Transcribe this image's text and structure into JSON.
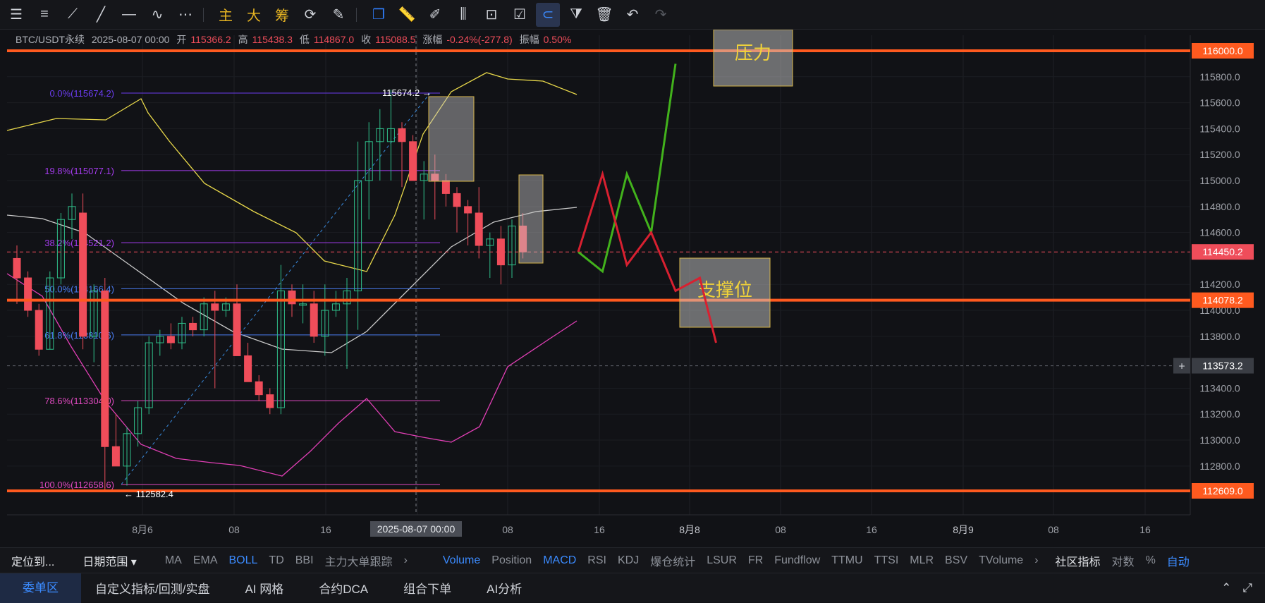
{
  "toolbar": {
    "text_tools": [
      "主",
      "大",
      "筹"
    ]
  },
  "info": {
    "symbol": "BTC/USDT永续",
    "datetime": "2025-08-07 00:00",
    "open_label": "开",
    "open": "115366.2",
    "high_label": "高",
    "high": "115438.3",
    "low_label": "低",
    "low": "114867.0",
    "close_label": "收",
    "close": "115088.5",
    "change_label": "涨幅",
    "change": "-0.24%(-277.8)",
    "amp_label": "振幅",
    "amp": "0.50%"
  },
  "colors": {
    "up": "#2fbf8a",
    "down": "#ef4d5a",
    "accent": "#3b8bff",
    "level": "#ff5a1f",
    "fib": "#8a3cf0"
  },
  "chart_data": {
    "type": "candlestick",
    "ylim": [
      112400,
      116200
    ],
    "y_ticks": [
      "115800.0",
      "115600.0",
      "115400.0",
      "115200.0",
      "115000.0",
      "114800.0",
      "114600.0",
      "114200.0",
      "114000.0",
      "113800.0",
      "113400.0",
      "113200.0",
      "113000.0",
      "112800.0"
    ],
    "x_ticks": [
      "8月6",
      "08",
      "16",
      "8月8",
      "08",
      "16",
      "8月9",
      "08",
      "16"
    ],
    "crosshair_x_label": "2025-08-07 00:00",
    "crosshair_top_label": "115674.2",
    "low_label": "← 112582.4",
    "fib_levels": [
      {
        "label": "0.0%(115674.2)",
        "price": 115674.2
      },
      {
        "label": "19.8%(115077.1)",
        "price": 115077.1
      },
      {
        "label": "38.2%(114521.2)",
        "price": 114521.2
      },
      {
        "label": "50.0%(114166.4)",
        "price": 114166.4
      },
      {
        "label": "61.8%(113810.6)",
        "price": 113810.6
      },
      {
        "label": "78.6%(113304.0)",
        "price": 113304.0
      },
      {
        "label": "100.0%(112658.6)",
        "price": 112658.6
      }
    ],
    "horizontal_levels": [
      {
        "price_label": "116000.0",
        "price": 116000.0
      },
      {
        "price_label": "114078.2",
        "price": 114078.2
      },
      {
        "price_label": "112609.0",
        "price": 112609.0
      }
    ],
    "current_price": {
      "label": "114450.2",
      "price": 114450.2
    },
    "cursor_price": {
      "label": "113573.2",
      "price": 113573.2
    },
    "annotations": [
      {
        "text": "压力",
        "price": 115900
      },
      {
        "text": "支撑位",
        "price": 114150
      }
    ],
    "candles": [
      [
        114400,
        114500,
        114050,
        114250
      ],
      [
        114250,
        114300,
        113950,
        114000
      ],
      [
        114000,
        114050,
        113650,
        113700
      ],
      [
        113700,
        114300,
        113700,
        114250
      ],
      [
        114250,
        114750,
        114200,
        114700
      ],
      [
        114700,
        114900,
        114550,
        114800
      ],
      [
        114750,
        114900,
        113700,
        113800
      ],
      [
        113800,
        114200,
        113600,
        114150
      ],
      [
        114150,
        114250,
        112600,
        112950
      ],
      [
        112950,
        113200,
        112800,
        112800
      ],
      [
        112800,
        113100,
        112650,
        113050
      ],
      [
        113050,
        113300,
        112950,
        113250
      ],
      [
        113250,
        113800,
        113200,
        113750
      ],
      [
        113750,
        113850,
        113650,
        113800
      ],
      [
        113800,
        113900,
        113700,
        113750
      ],
      [
        113750,
        113950,
        113700,
        113900
      ],
      [
        113900,
        113950,
        113800,
        113850
      ],
      [
        113850,
        114100,
        113800,
        114050
      ],
      [
        114050,
        114150,
        113400,
        114000
      ],
      [
        114000,
        114100,
        113950,
        114050
      ],
      [
        114050,
        114200,
        113900,
        113650
      ],
      [
        113650,
        113750,
        113500,
        113450
      ],
      [
        113450,
        113500,
        113300,
        113350
      ],
      [
        113350,
        113400,
        113200,
        113250
      ],
      [
        113250,
        114350,
        113200,
        114150
      ],
      [
        114150,
        114200,
        113950,
        114050
      ],
      [
        114050,
        114200,
        113900,
        114050
      ],
      [
        114050,
        114150,
        113750,
        113800
      ],
      [
        113800,
        114200,
        113650,
        114000
      ],
      [
        114000,
        114150,
        113950,
        114050
      ],
      [
        114050,
        114250,
        113550,
        114150
      ],
      [
        114150,
        115300,
        113850,
        115000
      ],
      [
        115000,
        115450,
        114700,
        115300
      ],
      [
        115300,
        115550,
        115000,
        115400
      ],
      [
        115300,
        115700,
        115000,
        115400
      ],
      [
        115400,
        115450,
        114950,
        115300
      ],
      [
        115300,
        115350,
        115000,
        115000
      ],
      [
        115000,
        115150,
        114700,
        115050
      ],
      [
        115050,
        115200,
        114700,
        115000
      ],
      [
        115000,
        115050,
        114800,
        114900
      ],
      [
        114900,
        114950,
        114600,
        114800
      ],
      [
        114800,
        114850,
        114500,
        114750
      ],
      [
        114750,
        114950,
        114400,
        114500
      ],
      [
        114500,
        114600,
        114250,
        114550
      ],
      [
        114550,
        114650,
        114200,
        114350
      ],
      [
        114350,
        114700,
        114250,
        114650
      ],
      [
        114650,
        114750,
        114400,
        114450
      ]
    ],
    "scenario_green": [
      [
        1,
        114450
      ],
      [
        4,
        114300
      ],
      [
        7,
        115050
      ],
      [
        10,
        114600
      ],
      [
        13,
        115900
      ]
    ],
    "scenario_red": [
      [
        1,
        114450
      ],
      [
        4,
        115050
      ],
      [
        7,
        114350
      ],
      [
        10,
        114600
      ],
      [
        13,
        114150
      ],
      [
        16,
        114250
      ],
      [
        18,
        113750
      ]
    ]
  },
  "bottom": {
    "locate": "定位到...",
    "range": "日期范围 ▾",
    "main_indicators": [
      "MA",
      "EMA",
      "BOLL",
      "TD",
      "BBI",
      "主力大单跟踪"
    ],
    "sub_indicators": [
      "Volume",
      "Position",
      "MACD",
      "RSI",
      "KDJ",
      "爆仓统计",
      "LSUR",
      "FR",
      "Fundflow",
      "TTMU",
      "TTSI",
      "MLR",
      "BSV",
      "TVolume"
    ],
    "community": "社区指标",
    "right": [
      "对数",
      "%",
      "自动"
    ]
  },
  "tabs": [
    "委单区",
    "自定义指标/回测/实盘",
    "AI 网格",
    "合约DCA",
    "组合下单",
    "AI分析"
  ]
}
